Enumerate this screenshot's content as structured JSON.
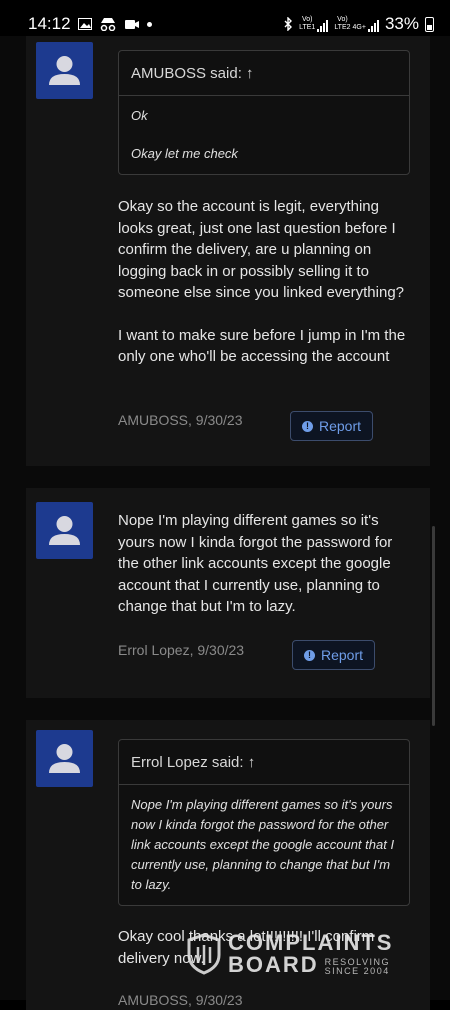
{
  "status_bar": {
    "time": "14:12",
    "net1_label": "Vo)\nLTE1",
    "net2_label": "Vo)\nLTE2",
    "net2_type": "4G+",
    "battery": "33%"
  },
  "posts": [
    {
      "quote_author": "AMUBOSS said: ↑",
      "quote_lines": [
        "Ok",
        "Okay let me check"
      ],
      "message_p1": "Okay so the account is legit, everything looks great, just one last question before I confirm the delivery, are u planning on logging back in or possibly selling it to someone else since you linked everything?",
      "message_p2": "I want to make sure before I jump in I'm the only one who'll be accessing the account",
      "meta": "AMUBOSS, 9/30/23",
      "report_label": "Report"
    },
    {
      "message_p1": "Nope I'm playing different games so it's yours now I kinda forgot the password for the other link accounts except the google account that I currently use, planning to change that but I'm to lazy.",
      "meta": "Errol Lopez, 9/30/23",
      "report_label": "Report"
    },
    {
      "quote_author": "Errol Lopez said: ↑",
      "quote_text": "Nope I'm playing different games so it's yours now I kinda forgot the password for the other link accounts except the google account that I currently use, planning to change that but I'm to lazy.",
      "message_p1": "Okay cool thanks a lot!!!!!!!!! I'll confirm delivery now.",
      "meta": "AMUBOSS, 9/30/23"
    }
  ],
  "watermark": {
    "line1": "COMPLAINTS",
    "line2": "BOARD",
    "tag1": "RESOLVING",
    "tag2": "SINCE 2004"
  }
}
